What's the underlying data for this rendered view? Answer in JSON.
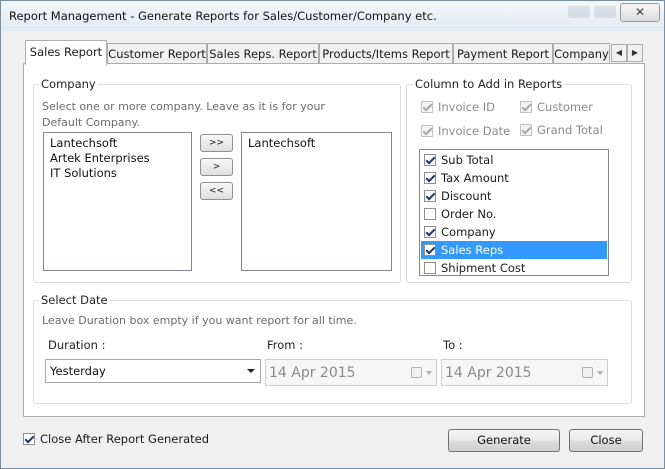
{
  "window": {
    "title": "Report Management - Generate Reports for Sales/Customer/Company etc.",
    "close_glyph": "✕"
  },
  "tabs": [
    {
      "label": "Sales Report",
      "active": true
    },
    {
      "label": "Customer Report"
    },
    {
      "label": "Sales Reps. Report"
    },
    {
      "label": "Products/Items Report"
    },
    {
      "label": "Payment Report"
    },
    {
      "label": "Company"
    }
  ],
  "tab_scroll": {
    "left": "◀",
    "right": "▶"
  },
  "company": {
    "group_label": "Company",
    "hint": "Select one or more company. Leave as it is for your Default Company.",
    "available": [
      "Lantechsoft",
      "Artek Enterprises",
      "IT Solutions"
    ],
    "selected": [
      "Lantechsoft"
    ],
    "buttons": {
      "add_all": ">>",
      "add": ">",
      "remove_all": "<<"
    }
  },
  "columns": {
    "group_label": "Column to Add in Reports",
    "fixed": [
      {
        "label": "Invoice ID",
        "checked": true
      },
      {
        "label": "Customer",
        "checked": true
      },
      {
        "label": "Invoice Date",
        "checked": true
      },
      {
        "label": "Grand Total",
        "checked": true
      }
    ],
    "list": [
      {
        "label": "Sub Total",
        "checked": true
      },
      {
        "label": "Tax Amount",
        "checked": true
      },
      {
        "label": "Discount",
        "checked": true
      },
      {
        "label": "Order No.",
        "checked": false
      },
      {
        "label": "Company",
        "checked": true
      },
      {
        "label": "Sales Reps",
        "checked": true,
        "selected": true
      },
      {
        "label": "Shipment Cost",
        "checked": false
      }
    ]
  },
  "select_date": {
    "group_label": "Select Date",
    "hint": "Leave Duration box empty if you want report for all time.",
    "duration_label": "Duration :",
    "duration_value": "Yesterday",
    "from_label": "From :",
    "from_value": "14 Apr 2015",
    "to_label": "To :",
    "to_value": "14 Apr 2015"
  },
  "footer": {
    "close_after_label": "Close After Report Generated",
    "close_after_checked": true,
    "generate_label": "Generate",
    "close_label": "Close"
  }
}
